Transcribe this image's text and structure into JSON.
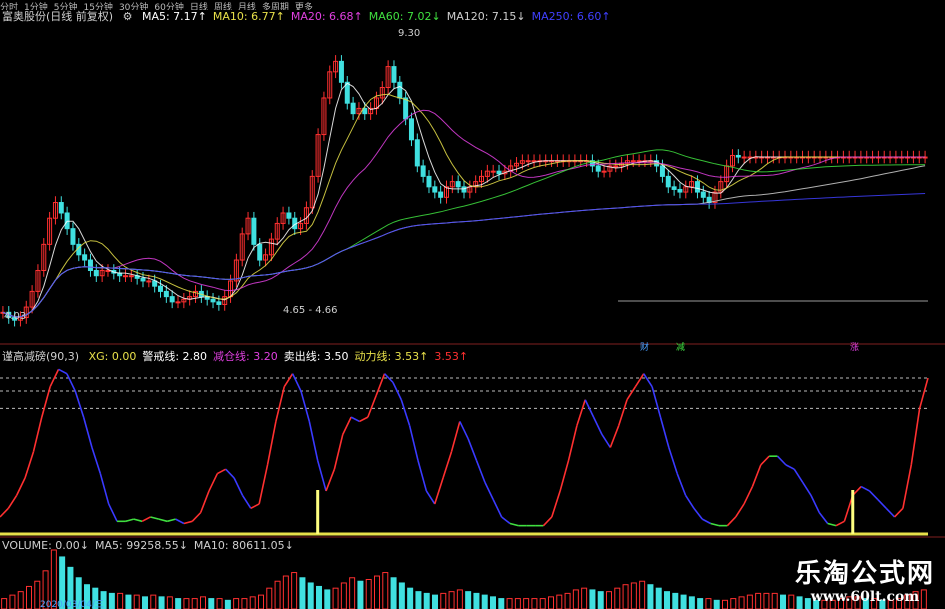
{
  "period_bar": [
    "分时",
    "1分钟",
    "5分钟",
    "15分钟",
    "30分钟",
    "60分钟",
    "日线",
    "周线",
    "月线",
    "多周期",
    "更多"
  ],
  "price_panel": {
    "stock_title": "富奥股份(日线 前复权)",
    "ma_legend": [
      {
        "label": "MA5: 7.17↑",
        "color": "#ffffff"
      },
      {
        "label": "MA10: 6.77↑",
        "color": "#e8e04a"
      },
      {
        "label": "MA20: 6.68↑",
        "color": "#e040e0"
      },
      {
        "label": "MA60: 7.02↓",
        "color": "#40e040"
      },
      {
        "label": "MA120: 7.15↓",
        "color": "#cfcfcf"
      },
      {
        "label": "MA250: 6.60↑",
        "color": "#4040ff"
      }
    ],
    "high_label": "9.30",
    "low_label_left": "4.03",
    "range_label": "4.65 - 4.66",
    "event_tags": [
      {
        "text": "财",
        "color": "#4aa0ff"
      },
      {
        "text": "减",
        "color": "#40e040"
      },
      {
        "text": "涨",
        "color": "#e040e0"
      }
    ]
  },
  "indicator_panel": {
    "title": "谨高减磅(90,3)",
    "legend": [
      {
        "label": "XG: 0.00",
        "color": "#e8e04a"
      },
      {
        "label": "警戒线: 2.80",
        "color": "#ffffff"
      },
      {
        "label": "减仓线: 3.20",
        "color": "#e040e0"
      },
      {
        "label": "卖出线: 3.50",
        "color": "#ffffff"
      },
      {
        "label": "动力线: 3.53↑",
        "color": "#e8e04a"
      },
      {
        "label": "3.53↑",
        "color": "#ff3030"
      }
    ]
  },
  "volume_panel": {
    "legend": [
      {
        "label": "VOLUME: 0.00↓",
        "color": "#cfcfcf"
      },
      {
        "label": "MA5: 99258.55↓",
        "color": "#cfcfcf"
      },
      {
        "label": "MA10: 80611.05↓",
        "color": "#cfcfcf"
      }
    ],
    "date_label": "2020/03/04/三"
  },
  "watermark": {
    "main": "乐淘公式网",
    "url": "www.60lt.com"
  },
  "chart_data": {
    "type": "line",
    "x": [
      0,
      1,
      2,
      3,
      4,
      5,
      6,
      7,
      8,
      9,
      10,
      11,
      12,
      13,
      14,
      15,
      16,
      17,
      18,
      19,
      20,
      21,
      22,
      23,
      24,
      25,
      26,
      27,
      28,
      29,
      30,
      31,
      32,
      33,
      34,
      35,
      36,
      37,
      38,
      39,
      40,
      41,
      42,
      43,
      44,
      45,
      46,
      47,
      48,
      49,
      50,
      51,
      52,
      53,
      54,
      55,
      56,
      57,
      58,
      59,
      60,
      61,
      62,
      63,
      64,
      65,
      66,
      67,
      68,
      69,
      70,
      71,
      72,
      73,
      74,
      75,
      76,
      77,
      78,
      79,
      80,
      81,
      82,
      83,
      84,
      85,
      86,
      87,
      88,
      89,
      90,
      91,
      92,
      93,
      94,
      95,
      96,
      97,
      98,
      99,
      100,
      101,
      102,
      103,
      104,
      105,
      106,
      107,
      108,
      109,
      110,
      111,
      112,
      113,
      114,
      115,
      116,
      117,
      118,
      119,
      120,
      121,
      122,
      123,
      124,
      125,
      126,
      127,
      128,
      129,
      130,
      131,
      132,
      133,
      134,
      135,
      136,
      137,
      138,
      139,
      140,
      141,
      142,
      143,
      144,
      145,
      146,
      147,
      148,
      149,
      150,
      151,
      152,
      153,
      154,
      155,
      156,
      157,
      158,
      159
    ],
    "price_close": [
      4.2,
      4.1,
      4.05,
      4.1,
      4.3,
      4.6,
      5.0,
      5.5,
      6.0,
      6.3,
      6.1,
      5.8,
      5.5,
      5.3,
      5.2,
      5.0,
      4.9,
      5.0,
      5.0,
      4.95,
      4.9,
      4.9,
      4.9,
      4.85,
      4.8,
      4.8,
      4.7,
      4.6,
      4.5,
      4.4,
      4.4,
      4.45,
      4.5,
      4.6,
      4.5,
      4.45,
      4.4,
      4.35,
      4.5,
      4.8,
      5.2,
      5.7,
      6.0,
      5.5,
      5.2,
      5.3,
      5.6,
      5.9,
      6.1,
      6.0,
      5.8,
      5.9,
      6.2,
      6.8,
      7.6,
      8.3,
      8.8,
      9.0,
      8.6,
      8.2,
      8.0,
      8.1,
      8.0,
      8.1,
      8.3,
      8.5,
      8.9,
      8.6,
      8.3,
      7.9,
      7.5,
      7.0,
      6.8,
      6.6,
      6.5,
      6.4,
      6.6,
      6.7,
      6.6,
      6.5,
      6.6,
      6.7,
      6.8,
      6.9,
      6.9,
      6.85,
      6.9,
      7.0,
      7.05,
      7.1,
      7.1,
      7.1,
      7.1,
      7.1,
      7.1,
      7.1,
      7.1,
      7.1,
      7.1,
      7.1,
      7.1,
      7.0,
      6.9,
      6.9,
      7.0,
      7.0,
      7.05,
      7.1,
      7.1,
      7.1,
      7.1,
      7.1,
      7.0,
      6.8,
      6.6,
      6.55,
      6.5,
      6.6,
      6.7,
      6.5,
      6.4,
      6.3,
      6.5,
      6.7,
      7.0,
      7.2,
      7.17,
      7.17,
      7.17,
      7.17,
      7.17,
      7.17,
      7.17,
      7.17,
      7.17,
      7.17,
      7.17,
      7.17,
      7.17,
      7.17,
      7.17,
      7.17,
      7.17,
      7.17,
      7.17,
      7.17,
      7.17,
      7.17,
      7.17,
      7.17,
      7.17,
      7.17,
      7.17,
      7.17,
      7.17,
      7.17,
      7.17,
      7.17,
      7.17
    ],
    "price_ylim": [
      3.9,
      9.6
    ],
    "indicator_values": [
      0.3,
      0.5,
      0.8,
      1.2,
      1.8,
      2.6,
      3.3,
      3.7,
      3.6,
      3.2,
      2.6,
      1.9,
      1.3,
      0.6,
      0.2,
      0.2,
      0.25,
      0.2,
      0.3,
      0.25,
      0.2,
      0.25,
      0.15,
      0.2,
      0.4,
      0.9,
      1.3,
      1.4,
      1.2,
      0.8,
      0.5,
      0.6,
      1.5,
      2.5,
      3.3,
      3.6,
      3.2,
      2.5,
      1.6,
      0.9,
      1.4,
      2.2,
      2.6,
      2.5,
      2.6,
      3.1,
      3.6,
      3.4,
      3.0,
      2.4,
      1.6,
      0.9,
      0.6,
      1.2,
      1.8,
      2.5,
      2.1,
      1.6,
      1.1,
      0.7,
      0.3,
      0.15,
      0.1,
      0.1,
      0.1,
      0.1,
      0.3,
      0.9,
      1.6,
      2.4,
      3.0,
      2.6,
      2.2,
      1.9,
      2.4,
      3.0,
      3.3,
      3.6,
      3.3,
      2.6,
      1.9,
      1.3,
      0.8,
      0.5,
      0.25,
      0.15,
      0.1,
      0.1,
      0.3,
      0.6,
      1.0,
      1.5,
      1.7,
      1.7,
      1.5,
      1.4,
      1.1,
      0.8,
      0.4,
      0.15,
      0.1,
      0.2,
      0.8,
      1.0,
      0.9,
      0.7,
      0.5,
      0.3,
      0.5,
      1.5,
      2.8,
      3.5
    ],
    "indicator_ylim": [
      0,
      3.8
    ],
    "indicator_reference_lines": [
      2.8,
      3.2,
      3.5
    ],
    "xg_signal_positions": [
      38,
      102
    ],
    "series": [
      {
        "name": "MA5",
        "values": []
      },
      {
        "name": "MA10",
        "values": []
      },
      {
        "name": "MA20",
        "values": []
      },
      {
        "name": "MA60",
        "values": []
      },
      {
        "name": "MA120",
        "values": []
      },
      {
        "name": "MA250",
        "values": []
      }
    ],
    "volume_values": [
      0.6,
      0.8,
      1.0,
      1.3,
      1.6,
      2.2,
      3.4,
      3.0,
      2.4,
      1.8,
      1.4,
      1.2,
      1.0,
      0.9,
      0.9,
      0.8,
      0.8,
      0.7,
      0.8,
      0.7,
      0.7,
      0.6,
      0.6,
      0.6,
      0.7,
      0.6,
      0.6,
      0.5,
      0.6,
      0.6,
      0.7,
      0.8,
      1.2,
      1.6,
      1.9,
      2.1,
      1.8,
      1.5,
      1.3,
      1.1,
      1.2,
      1.5,
      1.8,
      1.6,
      1.7,
      1.9,
      2.1,
      1.8,
      1.5,
      1.2,
      1.0,
      0.9,
      0.8,
      0.9,
      1.0,
      1.1,
      1.0,
      0.9,
      0.8,
      0.7,
      0.6,
      0.6,
      0.6,
      0.6,
      0.6,
      0.6,
      0.7,
      0.8,
      0.9,
      1.1,
      1.2,
      1.1,
      1.0,
      1.0,
      1.2,
      1.4,
      1.5,
      1.6,
      1.4,
      1.2,
      1.0,
      0.9,
      0.8,
      0.7,
      0.6,
      0.6,
      0.5,
      0.5,
      0.6,
      0.7,
      0.8,
      0.9,
      0.9,
      0.9,
      0.8,
      0.8,
      0.7,
      0.6,
      0.5,
      0.5,
      0.5,
      0.6,
      0.7,
      0.7,
      0.6,
      0.6,
      0.5,
      0.5,
      0.6,
      0.8,
      1.0,
      1.1
    ]
  }
}
